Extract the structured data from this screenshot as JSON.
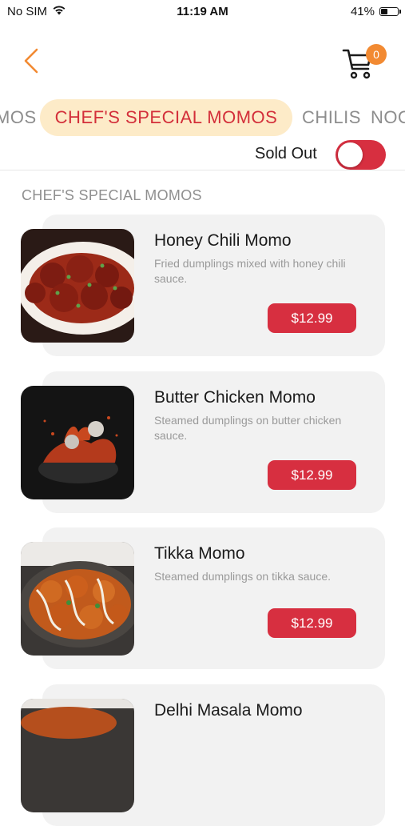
{
  "status_bar": {
    "carrier": "No SIM",
    "time": "11:19 AM",
    "battery": "41%",
    "battery_level": 0.41
  },
  "header": {
    "back_icon": "chevron-left-icon",
    "cart_icon": "cart-icon",
    "cart_count": "0",
    "accent_color": "#f28a32"
  },
  "tabs": [
    {
      "label": "MOS"
    },
    {
      "label": "CHEF'S SPECIAL MOMOS",
      "selected": true
    },
    {
      "label": "CHILIS"
    },
    {
      "label": "NOO"
    }
  ],
  "filter": {
    "sold_out_label": "Sold Out",
    "sold_out_on": false
  },
  "section": {
    "title": "CHEF'S SPECIAL MOMOS"
  },
  "items": [
    {
      "name": "Honey Chili Momo",
      "description": "Fried dumplings mixed with honey chili sauce.",
      "price": "$12.99"
    },
    {
      "name": "Butter Chicken Momo",
      "description": "Steamed dumplings on butter chicken sauce.",
      "price": "$12.99"
    },
    {
      "name": "Tikka Momo",
      "description": "Steamed dumplings on tikka sauce.",
      "price": "$12.99"
    },
    {
      "name": "Delhi Masala Momo",
      "description": "",
      "price": ""
    }
  ],
  "colors": {
    "primary_red": "#d72f40",
    "tab_highlight": "#fdebc8",
    "card_bg": "#f2f2f2"
  }
}
